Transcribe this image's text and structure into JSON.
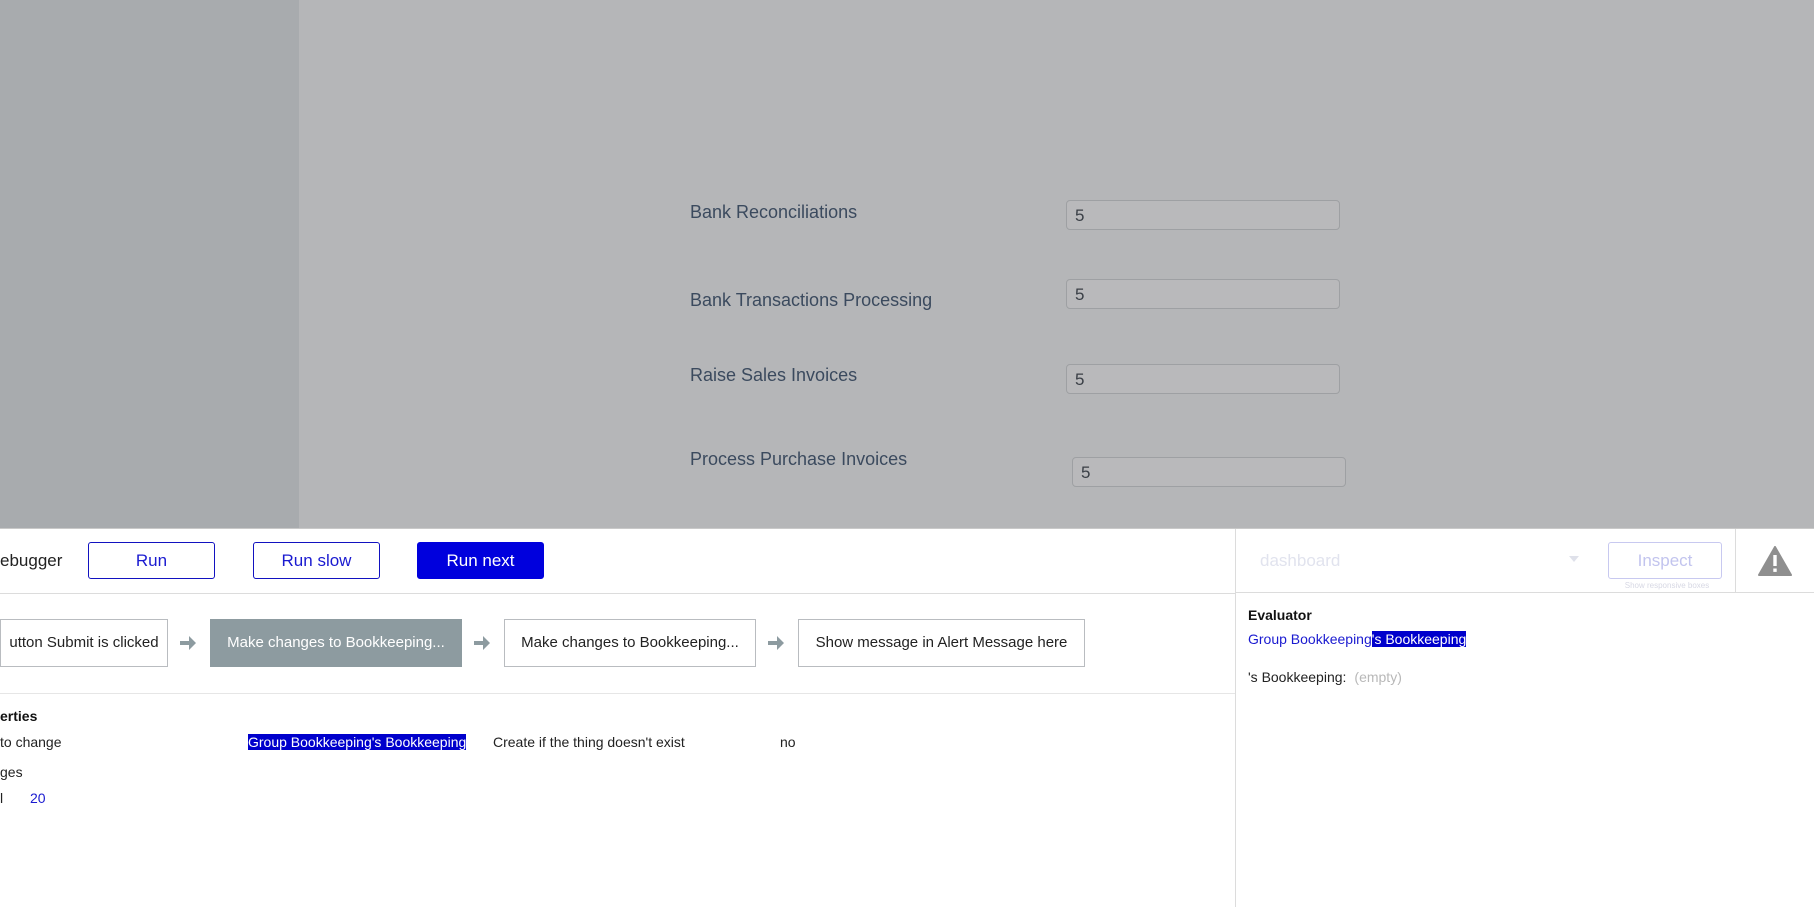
{
  "preview": {
    "fields": [
      {
        "label": "Bank Reconciliations",
        "value": "5"
      },
      {
        "label": "Bank Transactions Processing",
        "value": "5"
      },
      {
        "label": "Raise Sales Invoices",
        "value": "5"
      },
      {
        "label": "Process Purchase Invoices",
        "value": "5"
      }
    ]
  },
  "debugger": {
    "title": "ebugger",
    "run_label": "Run",
    "run_slow_label": "Run slow",
    "run_next_label": "Run next",
    "page_select_value": "dashboard",
    "inspect_label": "Inspect",
    "inspect_hint": "Show responsive boxes",
    "steps": [
      "utton Submit is clicked",
      "Make changes to Bookkeeping...",
      "Make changes to Bookkeeping...",
      "Show message in Alert Message here"
    ],
    "active_step": 1,
    "properties": {
      "heading": "erties",
      "thing_label": "to change",
      "thing_value": "Group Bookkeeping's Bookkeeping",
      "create_label": "Create if the thing doesn't exist",
      "create_value": "no",
      "changes_label": "ges",
      "field_label": "l",
      "field_value": "20"
    },
    "evaluator": {
      "title": "Evaluator",
      "expr_part1": "Group Bookkeeping",
      "expr_part2": "'s Bookkeeping",
      "result_label": "'s Bookkeeping:",
      "result_value": "(empty)"
    }
  },
  "colors": {
    "accent": "#0000dd",
    "active_step": "#8d9ba0",
    "overlay": "#b5b6b8"
  }
}
